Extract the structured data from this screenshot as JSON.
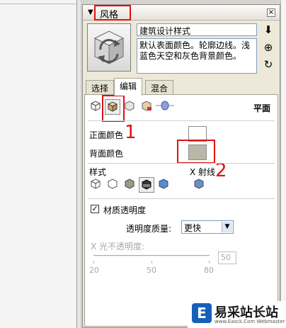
{
  "panel": {
    "title": "风格",
    "close_icon": "close-icon"
  },
  "style": {
    "name": "建筑设计样式",
    "description": "默认表面颜色。轮廓边线。浅蓝色天空和灰色背景颜色。"
  },
  "tabs": [
    {
      "label": "选择",
      "active": false
    },
    {
      "label": "编辑",
      "active": true
    },
    {
      "label": "混合",
      "active": false
    }
  ],
  "edit_mode_label": "平面",
  "face": {
    "front_color_label": "正面颜色",
    "front_color": "#ffffff",
    "back_color_label": "背面颜色",
    "back_color": "#b9b8a8"
  },
  "styles_section": {
    "label": "样式",
    "xray_label": "X 射线"
  },
  "transparency": {
    "checkbox_label": "材质透明度",
    "checked": true,
    "quality_label": "透明度质量:",
    "quality_value": "更快",
    "opacity_label": "X 光不透明度:",
    "opacity_value": "50",
    "ticks": [
      "20",
      "50",
      "80"
    ]
  },
  "annotations": {
    "num1": "1",
    "num2": "2"
  },
  "watermark": {
    "text": "易采站长站",
    "sub": "www.Easck.Com Webmaster"
  }
}
